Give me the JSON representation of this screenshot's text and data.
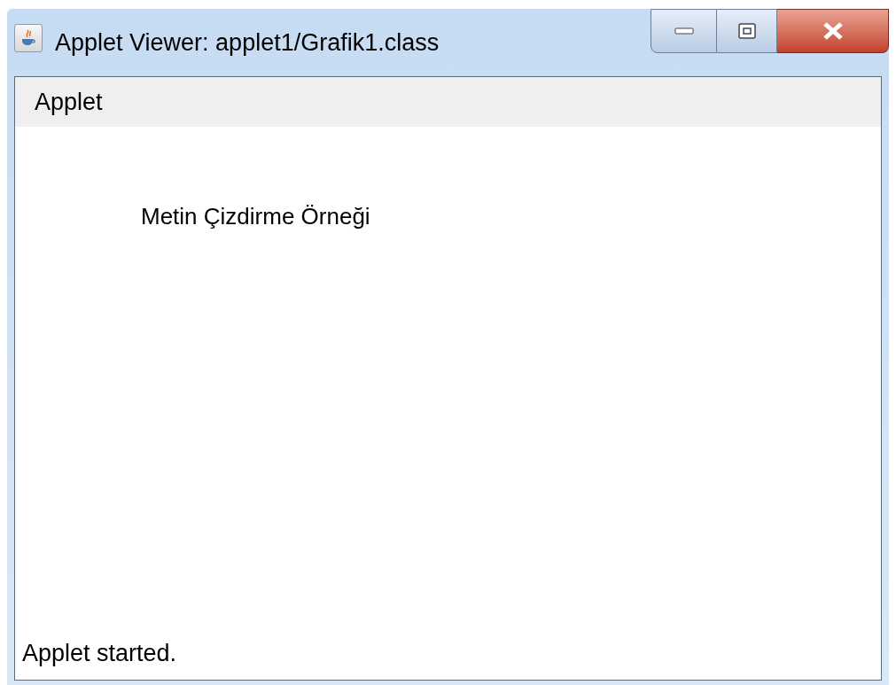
{
  "window": {
    "title": "Applet Viewer: applet1/Grafik1.class"
  },
  "menu_bar": {
    "items": [
      "Applet"
    ]
  },
  "canvas": {
    "text": "Metin Çizdirme Örneği"
  },
  "status_bar": "Applet started."
}
